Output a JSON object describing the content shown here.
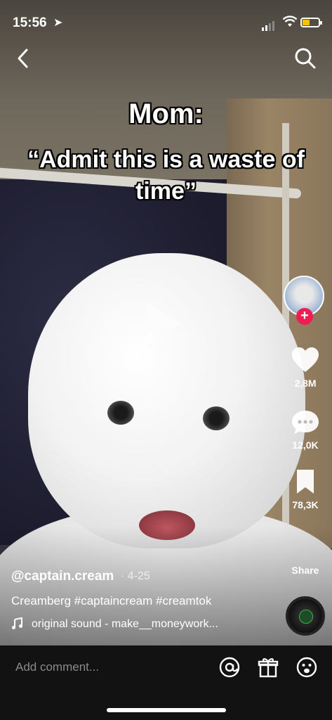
{
  "status_bar": {
    "time": "15:56"
  },
  "overlay_caption": {
    "line1": "Mom:",
    "line2": "“Admit this is a waste of time”"
  },
  "side_rail": {
    "likes": "2,8M",
    "comments": "12,0K",
    "saves": "78,3K",
    "share_label": "Share"
  },
  "post": {
    "username": "@captain.cream",
    "date": "· 4-25",
    "description": "Creamberg #captaincream #creamtok",
    "sound": "original sound - make__moneywork..."
  },
  "comment_bar": {
    "placeholder": "Add comment..."
  },
  "icons": [
    "back-icon",
    "search-icon",
    "heart-icon",
    "comment-icon",
    "bookmark-icon",
    "music-note-icon",
    "mention-icon",
    "gift-icon",
    "emoji-icon"
  ]
}
